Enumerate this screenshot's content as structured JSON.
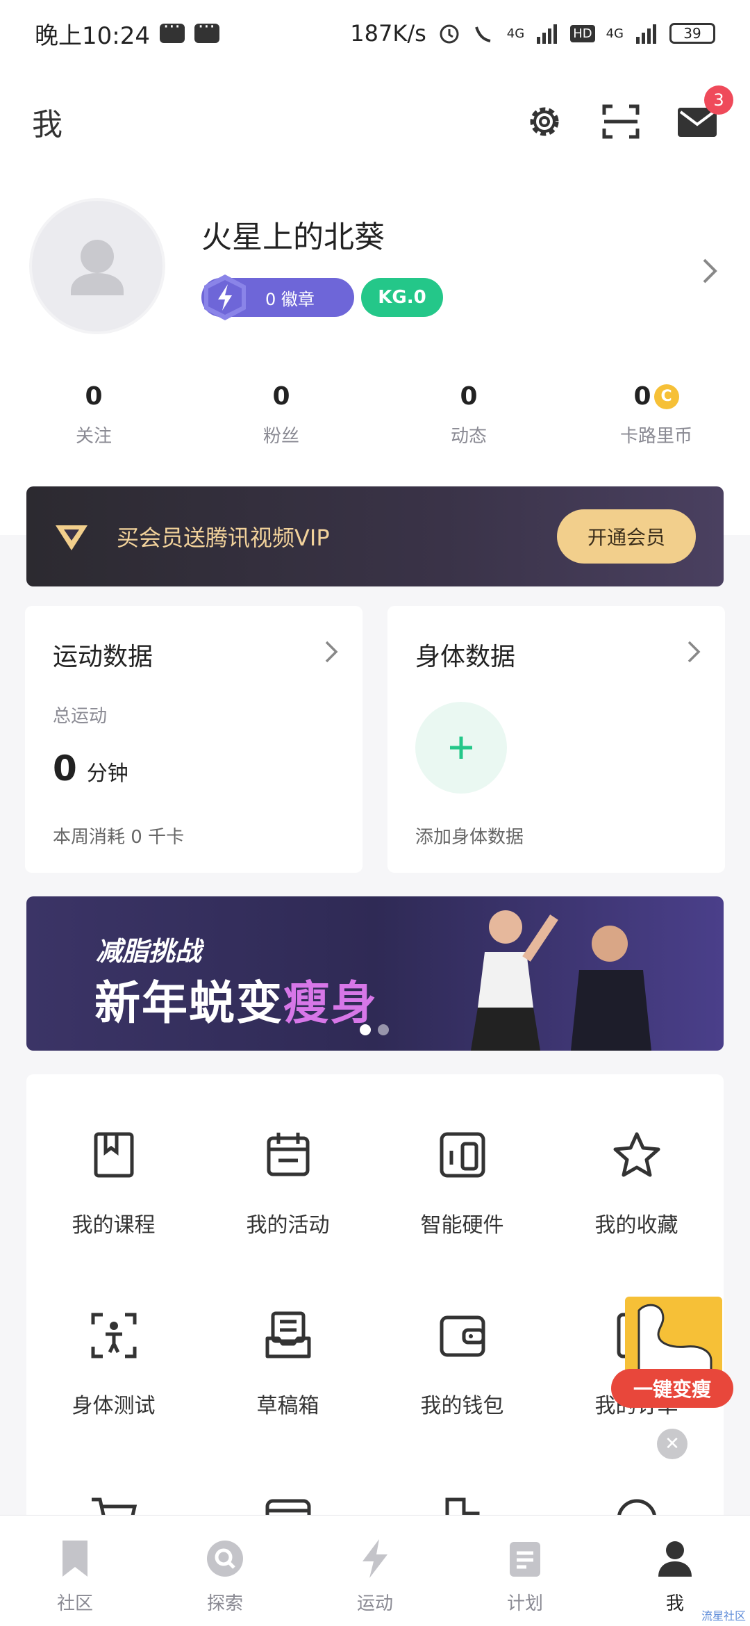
{
  "status_bar": {
    "time": "晚上10:24",
    "net_speed": "187K/s",
    "signal1": "4G",
    "hd": "HD",
    "signal2": "4G",
    "battery": "39"
  },
  "header": {
    "title": "我",
    "mail_badge": "3"
  },
  "profile": {
    "username": "火星上的北葵",
    "badge_count": "0 徽章",
    "kg_level": "KG.0"
  },
  "stats": [
    {
      "value": "0",
      "label": "关注"
    },
    {
      "value": "0",
      "label": "粉丝"
    },
    {
      "value": "0",
      "label": "动态"
    },
    {
      "value": "0",
      "label": "卡路里币"
    }
  ],
  "vip": {
    "text": "买会员送腾讯视频VIP",
    "button": "开通会员"
  },
  "exercise_card": {
    "title": "运动数据",
    "subtitle": "总运动",
    "value": "0",
    "unit": "分钟",
    "footer": "本周消耗 0 千卡"
  },
  "body_card": {
    "title": "身体数据",
    "add_label": "添加身体数据"
  },
  "promo": {
    "line1": "减脂挑战",
    "line2a": "新年蜕变",
    "line2b": "瘦身"
  },
  "grid": [
    {
      "label": "我的课程",
      "icon": "book-icon"
    },
    {
      "label": "我的活动",
      "icon": "calendar-icon"
    },
    {
      "label": "智能硬件",
      "icon": "device-icon"
    },
    {
      "label": "我的收藏",
      "icon": "star-icon"
    },
    {
      "label": "身体测试",
      "icon": "body-scan-icon"
    },
    {
      "label": "草稿箱",
      "icon": "draft-icon"
    },
    {
      "label": "我的钱包",
      "icon": "wallet-icon"
    },
    {
      "label": "我的订单",
      "icon": "order-icon"
    }
  ],
  "floating": {
    "label": "一键变瘦"
  },
  "tabs": [
    {
      "label": "社区",
      "icon": "bookmark-icon"
    },
    {
      "label": "探索",
      "icon": "explore-icon"
    },
    {
      "label": "运动",
      "icon": "lightning-icon"
    },
    {
      "label": "计划",
      "icon": "plan-icon"
    },
    {
      "label": "我",
      "icon": "person-icon"
    }
  ],
  "watermark": "流星社区"
}
